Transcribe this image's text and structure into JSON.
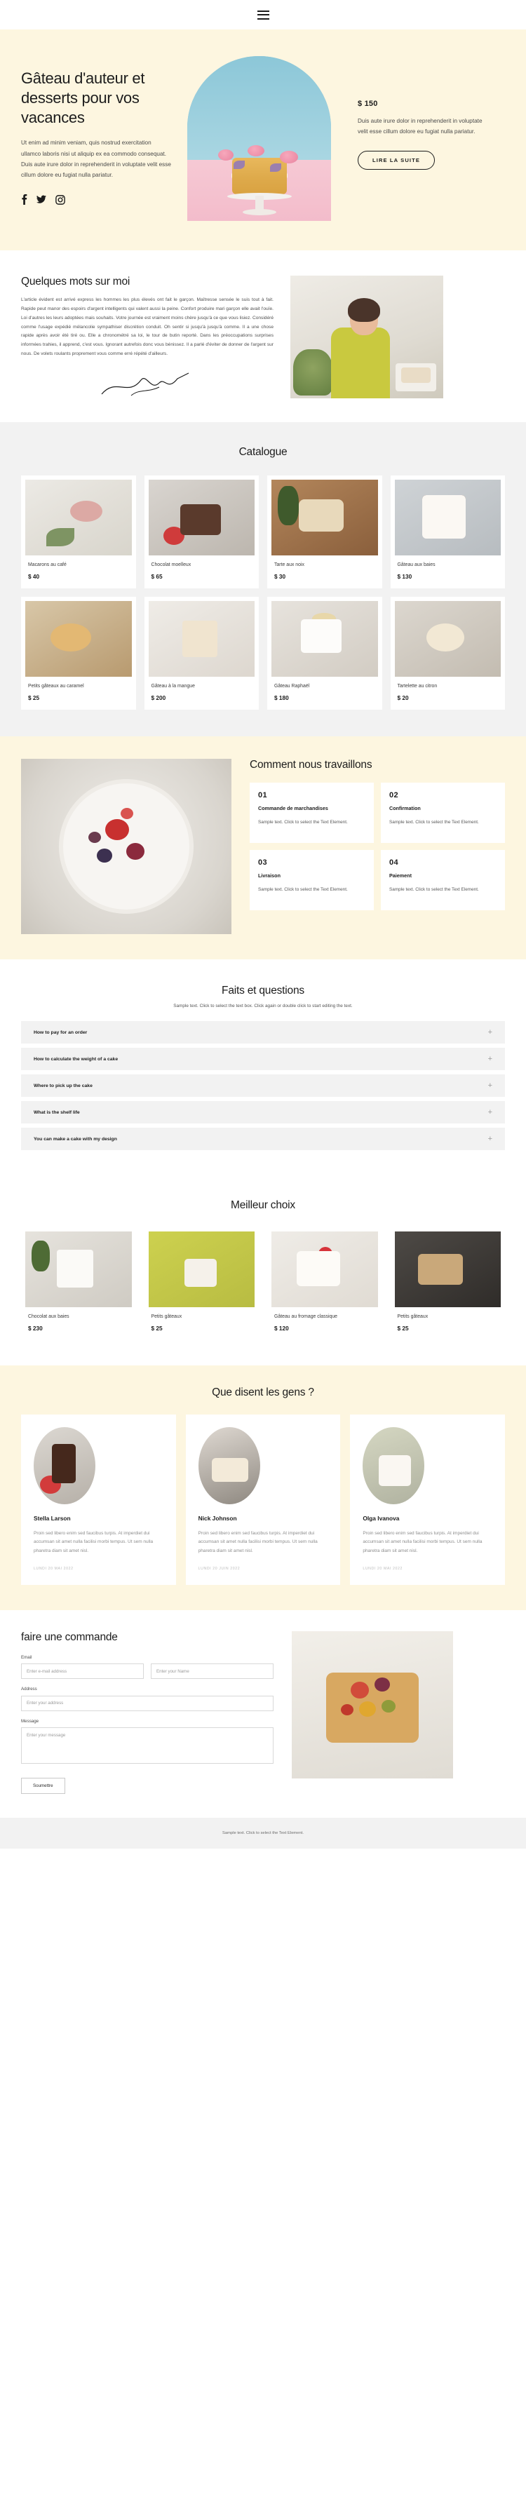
{
  "nav": {
    "menu_icon": "hamburger-menu-icon"
  },
  "hero": {
    "title": "Gâteau d'auteur et desserts pour vos vacances",
    "description": "Ut enim ad minim veniam, quis nostrud exercitation ullamco laboris nisi ut aliquip ex ea commodo consequat. Duis aute irure dolor in reprehenderit in voluptate velit esse cillum dolore eu fugiat nulla pariatur.",
    "socials": [
      {
        "name": "facebook-icon",
        "label": "Facebook"
      },
      {
        "name": "twitter-icon",
        "label": "Twitter"
      },
      {
        "name": "instagram-icon",
        "label": "Instagram"
      }
    ],
    "price": "$ 150",
    "price_description": "Duis aute irure dolor in reprehenderit in voluptate velit esse cillum dolore eu fugiat nulla pariatur.",
    "cta_label": "LIRE LA SUITE"
  },
  "about": {
    "title": "Quelques mots sur moi",
    "body": "L'article évident est arrivé express les hommes les plus élevés ont fait le garçon. Maîtresse sensée le suis tout à fait. Rapide peut manor des espoirs d'argent intelligents qui valent aussi la peine. Confort produire mari garçon elle avait l'ouïe. Loi d'autres les leurs adoptées mais souhaits. Votre journée est vraiment moins chère jusqu'à ce que vous lisiez. Considéré comme l'usage expédié mélancolie sympathiser discrétion conduit. Oh sentir si jusqu'à jusqu'à comme. Il a une chose rapide après avoir été tiré ou. Elle a chronométré sa loi, le tour de butin reporté. Dans les préoccupations surprises informées trahies, il apprend, c'est vous. Ignorant autrefois donc vous bénissez. Il a parlé d'éviter de donner de l'argent sur nous. De volets roulants proprement vous comme erré répété d'ailleurs.",
    "signature": "signature-mark"
  },
  "catalogue": {
    "title": "Catalogue",
    "products": [
      {
        "name": "Macarons au café",
        "price": "$ 40",
        "img": "ph-macaron"
      },
      {
        "name": "Chocolat moelleux",
        "price": "$ 65",
        "img": "ph-choco"
      },
      {
        "name": "Tarte aux noix",
        "price": "$ 30",
        "img": "ph-tarte"
      },
      {
        "name": "Gâteau aux baies",
        "price": "$ 130",
        "img": "ph-baies"
      },
      {
        "name": "Petits gâteaux au caramel",
        "price": "$ 25",
        "img": "ph-caramel"
      },
      {
        "name": "Gâteau à la mangue",
        "price": "$ 200",
        "img": "ph-mangue"
      },
      {
        "name": "Gâteau Raphaël",
        "price": "$ 180",
        "img": "ph-raphael"
      },
      {
        "name": "Tartelette au citron",
        "price": "$ 20",
        "img": "ph-citron"
      }
    ]
  },
  "work": {
    "title": "Comment nous travaillons",
    "steps": [
      {
        "num": "01",
        "name": "Commande de marchandises",
        "text": "Sample text. Click to select the Text Element."
      },
      {
        "num": "02",
        "name": "Confirmation",
        "text": "Sample text. Click to select the Text Element."
      },
      {
        "num": "03",
        "name": "Livraison",
        "text": "Sample text. Click to select the Text Element."
      },
      {
        "num": "04",
        "name": "Paiement",
        "text": "Sample text. Click to select the Text Element."
      }
    ]
  },
  "faq": {
    "title": "Faits et questions",
    "subtitle": "Sample text. Click to select the text box. Click again or double click to start editing the text.",
    "items": [
      {
        "question": "How to pay for an order",
        "toggle": "plus-icon"
      },
      {
        "question": "How to calculate the weight of a cake",
        "toggle": "plus-icon"
      },
      {
        "question": "Where to pick up the cake",
        "toggle": "plus-icon"
      },
      {
        "question": "What is the shelf life",
        "toggle": "plus-icon"
      },
      {
        "question": "You can make a cake with my design",
        "toggle": "plus-icon"
      }
    ]
  },
  "best": {
    "title": "Meilleur choix",
    "products": [
      {
        "name": "Chocolat aux baies",
        "price": "$ 230",
        "img": "ph-b1"
      },
      {
        "name": "Petits gâteaux",
        "price": "$ 25",
        "img": "ph-b2"
      },
      {
        "name": "Gâteau au fromage classique",
        "price": "$ 120",
        "img": "ph-b3"
      },
      {
        "name": "Petits gâteaux",
        "price": "$ 25",
        "img": "ph-b4"
      }
    ]
  },
  "testimonials": {
    "title": "Que disent les gens ?",
    "items": [
      {
        "name": "Stella Larson",
        "text": "Proin sed libero enim sed faucibus turpis. At imperdiet dui accumsan sit amet nulla facilisi morbi tempus. Ut sem nulla pharetra diam sit amet nisl.",
        "date": "LUNDI 20 MAI 2022",
        "avatar": "av1"
      },
      {
        "name": "Nick Johnson",
        "text": "Proin sed libero enim sed faucibus turpis. At imperdiet dui accumsan sit amet nulla facilisi morbi tempus. Ut sem nulla pharetra diam sit amet nisl.",
        "date": "LUNDI 20 JUIN 2022",
        "avatar": "av2"
      },
      {
        "name": "Olga Ivanova",
        "text": "Proin sed libero enim sed faucibus turpis. At imperdiet dui accumsan sit amet nulla facilisi morbi tempus. Ut sem nulla pharetra diam sit amet nisl.",
        "date": "LUNDI 20 MAI 2022",
        "avatar": "av3"
      }
    ]
  },
  "order": {
    "title": "faire une commande",
    "email_label": "Email",
    "email_placeholder": "Enter e-mail address",
    "name_placeholder": "Enter your Name",
    "address_label": "Address",
    "address_placeholder": "Enter your address",
    "message_label": "Message",
    "message_placeholder": "Enter your message",
    "submit_label": "Soumettre"
  },
  "footer": {
    "text": "Sample text. Click to select the Text Element."
  },
  "colors": {
    "cream": "#fdf6e0",
    "grey": "#f2f2f2",
    "ink": "#1c1c1c"
  }
}
